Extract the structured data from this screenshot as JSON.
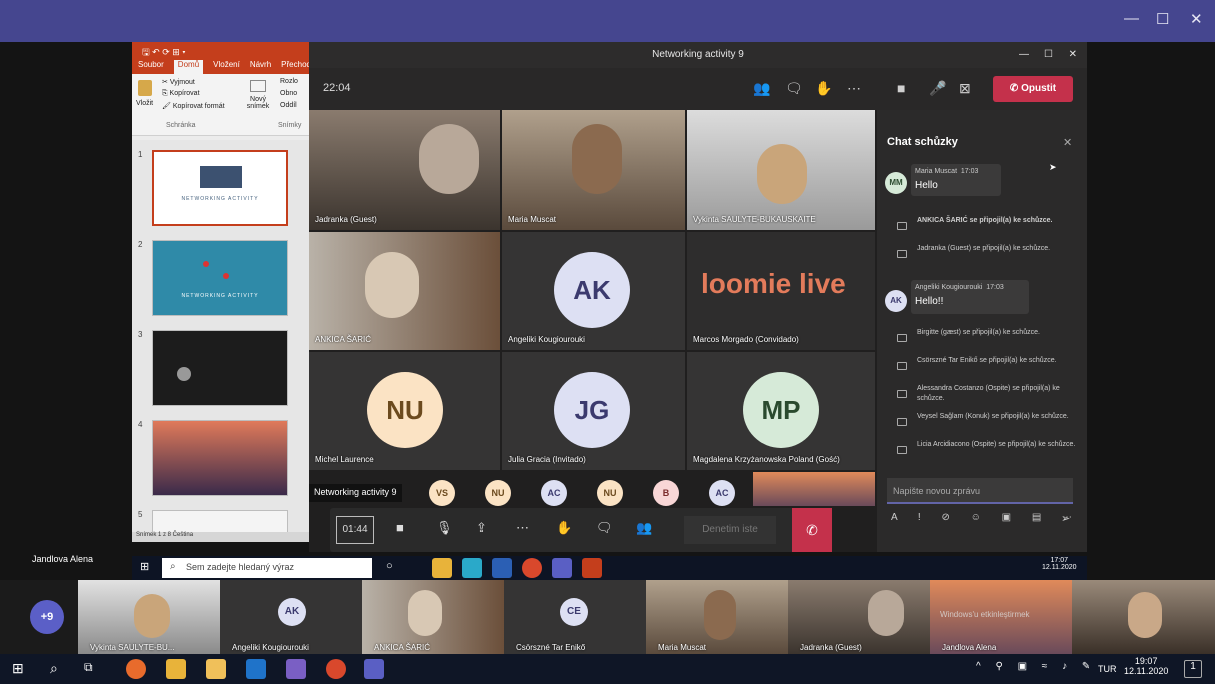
{
  "window": {
    "title": "Networking activity 9",
    "minimize": "—",
    "maximize": "☐",
    "close": "✕"
  },
  "ppt": {
    "title": "🖫 ↶ ⟳ ⊞ ▾",
    "tabs": [
      "Soubor",
      "Domů",
      "Vložení",
      "Návrh",
      "Přechod"
    ],
    "ribbon": {
      "paste": "Vložit",
      "cut": "Vyjmout",
      "copy": "Kopírovat",
      "format": "Kopírovat formát",
      "new_slide": "Nový snímek",
      "layout": "Rozlo",
      "reset": "Obno",
      "section": "Oddíl",
      "group_clipboard": "Schránka",
      "group_slides": "Snímky"
    },
    "slides": [
      {
        "num": "1",
        "title": "NETWORKING ACTIVITY"
      },
      {
        "num": "2",
        "title": "NETWORKING ACTIVITY"
      },
      {
        "num": "3",
        "title": ""
      },
      {
        "num": "4",
        "title": ""
      },
      {
        "num": "5",
        "title": ""
      }
    ],
    "status": "Snímek 1 z 8    Čeština"
  },
  "teams": {
    "title": "Networking activity 9",
    "timer": "22:04",
    "leave": "Opustit",
    "tiles": [
      {
        "name": "Jadranka (Guest)"
      },
      {
        "name": "Maria Muscat"
      },
      {
        "name": "Vykinta SAULYTE-BUKAUSKAITE"
      },
      {
        "name": "ANKICA ŠARIĆ"
      },
      {
        "name": "Angeliki Kougiourouki",
        "initials": "AK"
      },
      {
        "name": "Marcos Morgado (Convidado)",
        "logo_a": "loomie",
        "logo_b": " live"
      },
      {
        "name": "Michel Laurence",
        "initials": "NU"
      },
      {
        "name": "Julia Gracia (Invitado)",
        "initials": "JG"
      },
      {
        "name": "Magdalena Krzyżanowska Poland (Gość)",
        "initials": "MP"
      }
    ],
    "overflow": [
      "VS",
      "NU",
      "AC",
      "NU",
      "B",
      "AC"
    ],
    "tooltip": "Networking activity 9",
    "control_timer": "01:44",
    "denetim": "Denetim iste"
  },
  "chat": {
    "title": "Chat schůzky",
    "messages": [
      {
        "initials": "MM",
        "author": "Maria Muscat",
        "time": "17:03",
        "text": "Hello"
      },
      {
        "initials": "AK",
        "author": "Angeliki Kougiourouki",
        "time": "17:03",
        "text": "Hello!!"
      }
    ],
    "system": [
      "ANKICA ŠARIĆ se připojil(a) ke schůzce.",
      "Jadranka (Guest) se připojil(a) ke schůzce.",
      "Birgitte (gæst) se připojil(a) ke schůzce.",
      "Csörszné Tar Enikő se připojil(a) ke schůzce.",
      "Alessandra Costanzo (Ospite) se připojil(a) ke schůzce.",
      "Veysel Sağlam (Konuk) se připojil(a) ke schůzce.",
      "Licia Arcidiacono (Ospite) se připojil(a) ke schůzce."
    ],
    "placeholder": "Napište novou zprávu"
  },
  "taskbar1": {
    "search": "Sem zadejte hledaný výraz",
    "time": "17:07",
    "date": "12.11.2020"
  },
  "presenter_label": "Jandlova Alena",
  "gallery": {
    "more": "+9",
    "tiles": [
      {
        "name": "Vykinta SAULYTE-BU..."
      },
      {
        "name": "Angeliki Kougiourouki",
        "initials": "AK"
      },
      {
        "name": "ANKICA ŠARIĆ"
      },
      {
        "name": "Csörszné Tar Enikő",
        "initials": "CE"
      },
      {
        "name": "Maria Muscat"
      },
      {
        "name": "Jadranka (Guest)"
      },
      {
        "name": "Jandlova Alena"
      }
    ],
    "watermark": "Windows'u etkinleştirmek"
  },
  "taskbar2": {
    "lang": "TUR",
    "time": "19:07",
    "date": "12.11.2020",
    "notif": "1"
  },
  "colors": {
    "teams_purple": "#45468f",
    "leave_red": "#c4314b",
    "ppt_red": "#c43e1c"
  }
}
